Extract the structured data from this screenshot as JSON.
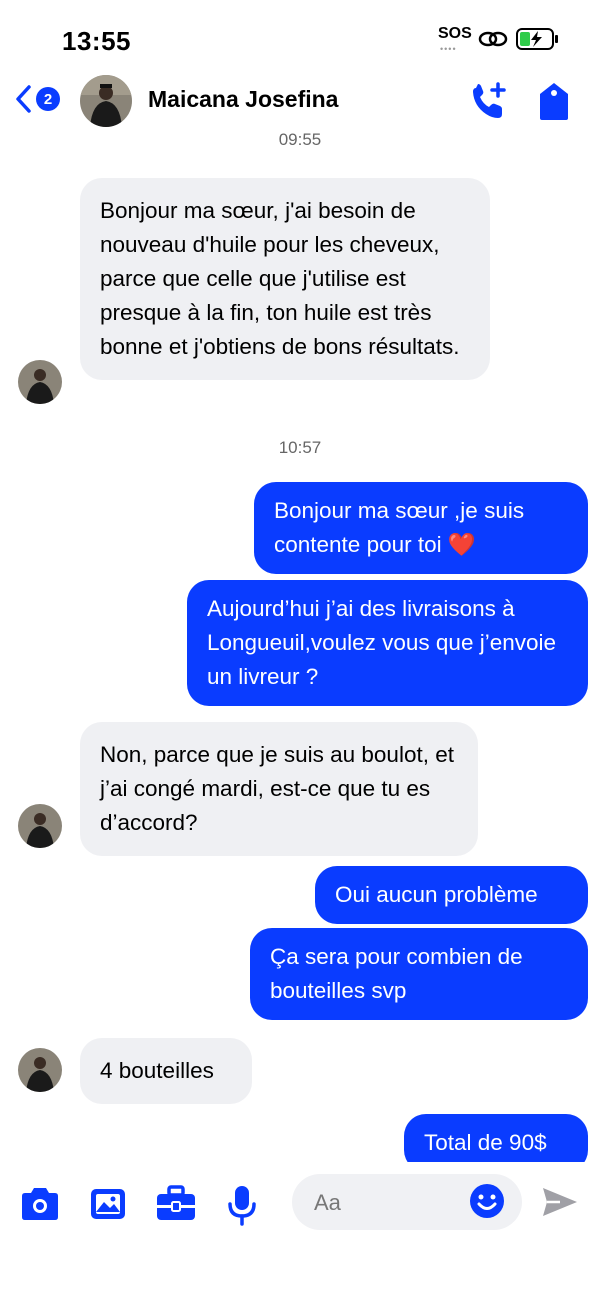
{
  "status": {
    "time": "13:55",
    "sos": "SOS"
  },
  "header": {
    "badge_count": "2",
    "contact_name": "Maicana Josefina"
  },
  "messages": [
    {
      "type": "timestamp",
      "text": "09:55"
    },
    {
      "type": "incoming",
      "text": "Bonjour ma sœur, j'ai besoin de nouveau d'huile pour les cheveux, parce que celle que j'utilise est presque à la fin, ton huile est très bonne et j'obtiens de bons résultats."
    },
    {
      "type": "timestamp",
      "text": "10:57"
    },
    {
      "type": "outgoing",
      "text": "Bonjour ma sœur ,je suis contente pour toi",
      "emoji": "❤️"
    },
    {
      "type": "outgoing",
      "text": "Aujourd’hui j’ai des livraisons à Longueuil,voulez vous que j’envoie un livreur ?"
    },
    {
      "type": "incoming",
      "text": "Non, parce que  je suis au boulot, et j’ai congé mardi, est-ce que tu es d’accord?"
    },
    {
      "type": "outgoing",
      "text": "Oui aucun problème"
    },
    {
      "type": "outgoing",
      "text": "Ça sera pour combien de bouteilles svp"
    },
    {
      "type": "incoming",
      "text": "4 bouteilles"
    },
    {
      "type": "outgoing",
      "text": "Total de 90$"
    }
  ],
  "composer": {
    "placeholder": "Aa"
  },
  "colors": {
    "accent": "#0a3cff",
    "incoming_bubble": "#eff0f3"
  },
  "icons": [
    "back-chevron-icon",
    "phone-add-icon",
    "tag-icon",
    "camera-icon",
    "image-icon",
    "briefcase-icon",
    "microphone-icon",
    "emoji-icon",
    "send-icon",
    "link-icon",
    "battery-charging-icon"
  ]
}
